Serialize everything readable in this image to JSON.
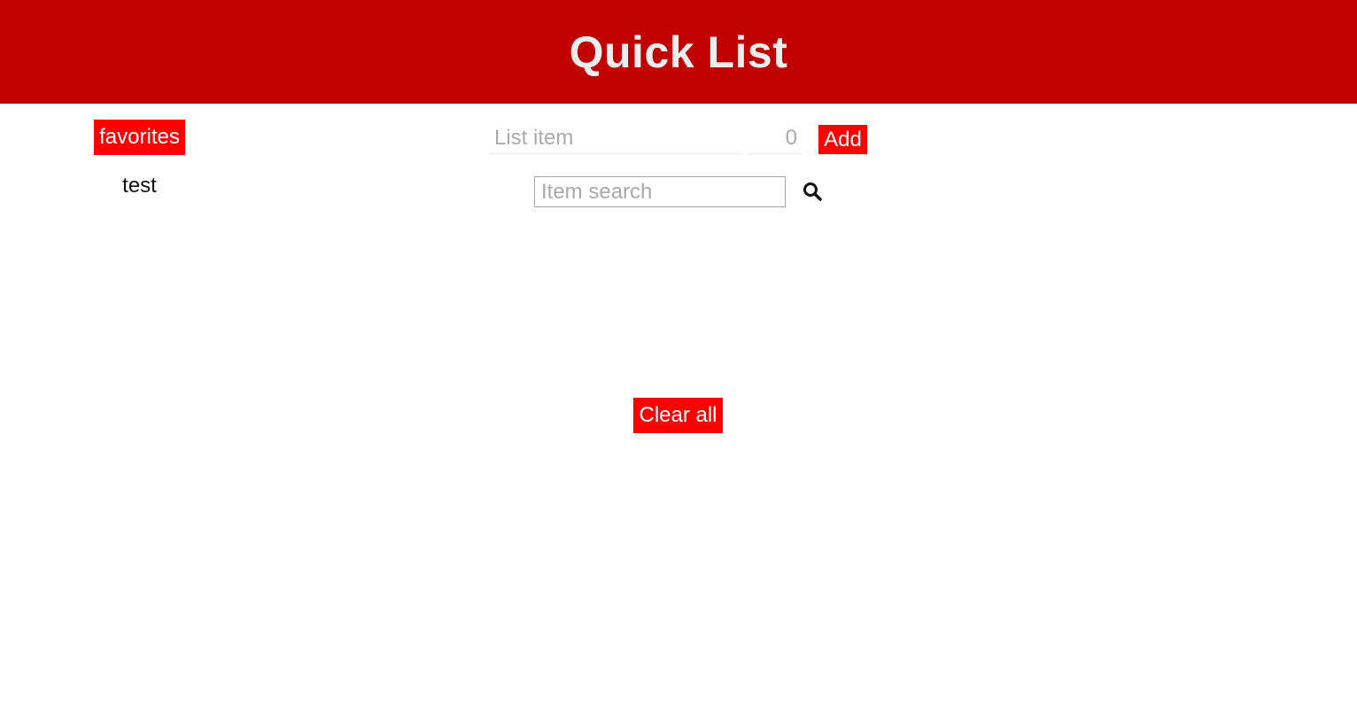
{
  "header": {
    "title": "Quick List"
  },
  "sidebar": {
    "favorites_label": "favorites",
    "lists": [
      {
        "label": "test"
      }
    ]
  },
  "add_form": {
    "item_placeholder": "List item",
    "quantity_placeholder": "0",
    "add_label": "Add"
  },
  "search": {
    "placeholder": "Item search",
    "icon": "search-icon"
  },
  "actions": {
    "clear_label": "Clear all"
  },
  "colors": {
    "header_bg": "#c10000",
    "button_bg": "#ff0000",
    "title_text": "#ededed"
  }
}
